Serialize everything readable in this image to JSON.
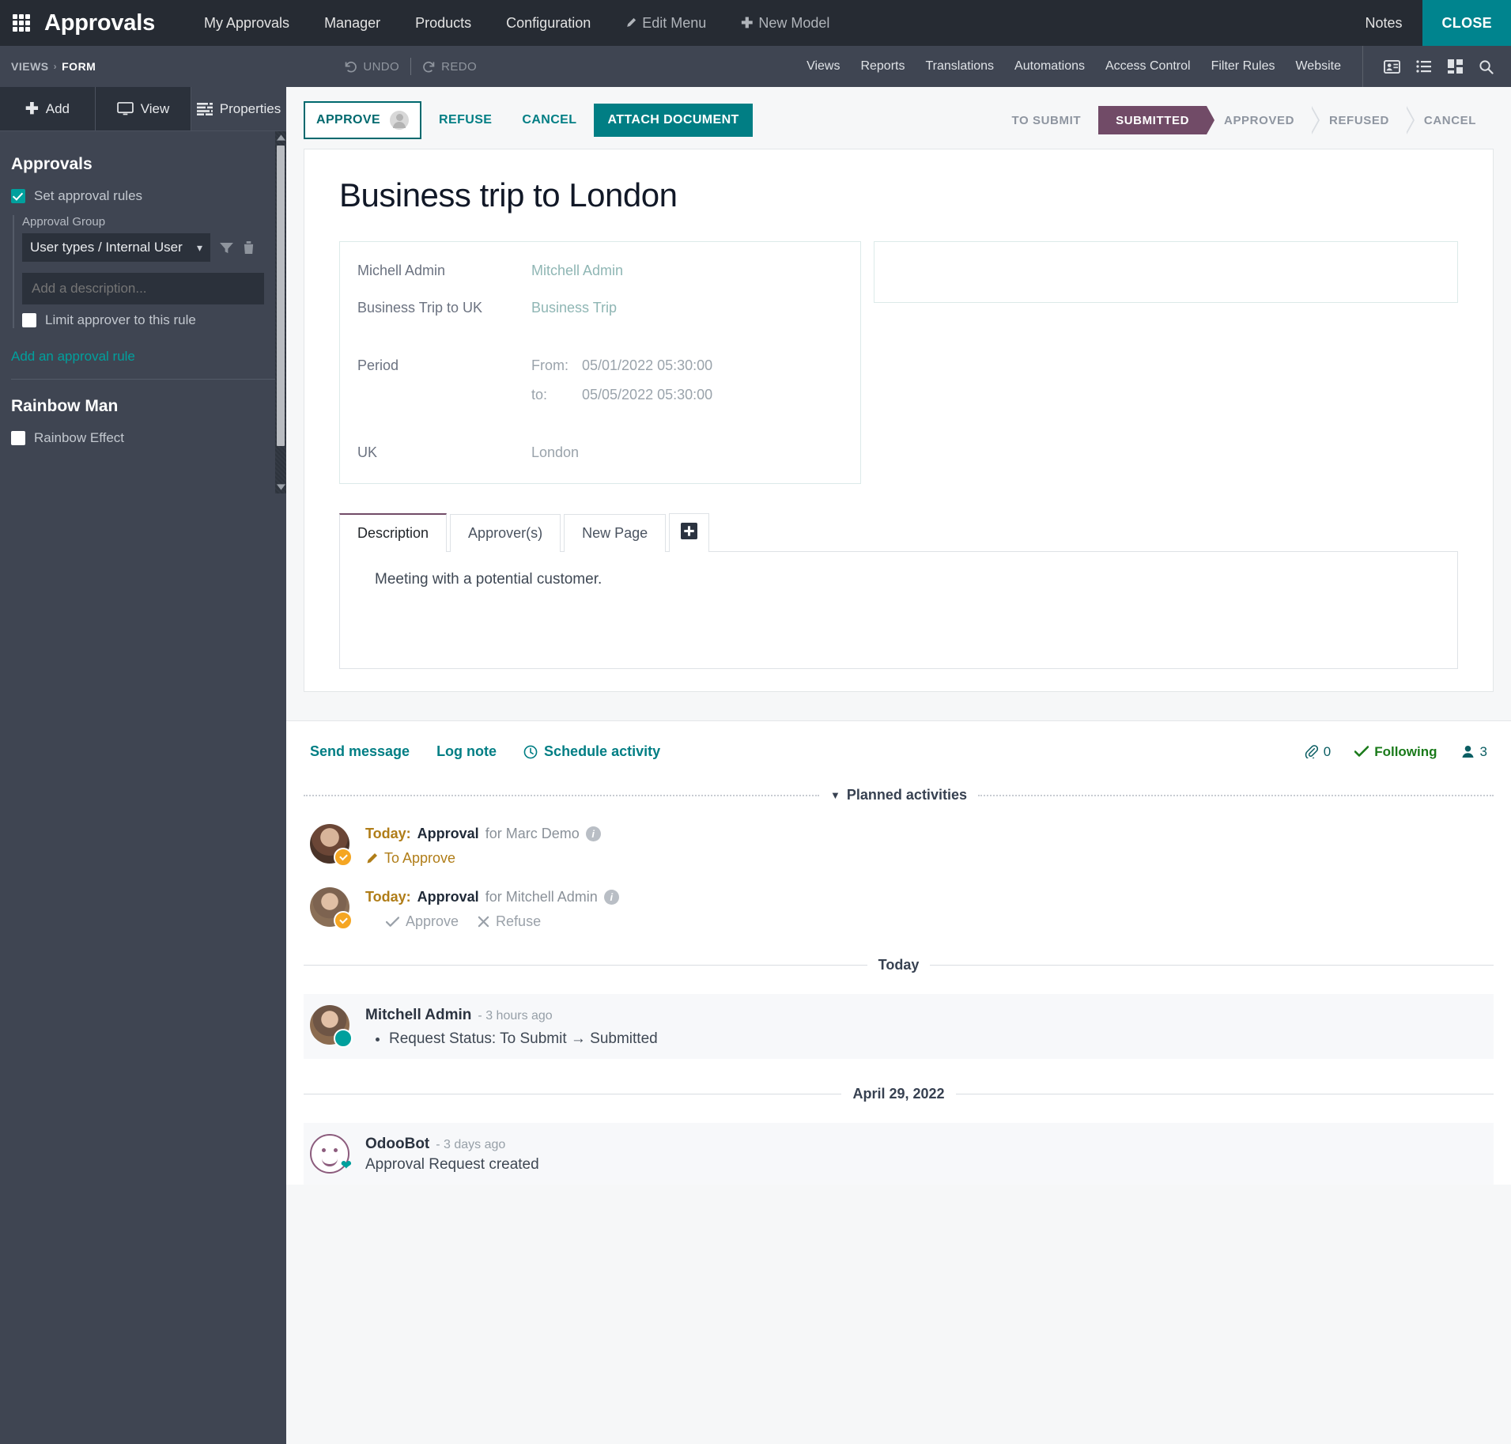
{
  "navbar": {
    "apps_icon": "apps-grid-icon",
    "brand": "Approvals",
    "menus": [
      {
        "label": "My Approvals"
      },
      {
        "label": "Manager"
      },
      {
        "label": "Products"
      },
      {
        "label": "Configuration"
      }
    ],
    "edit_menu": "Edit Menu",
    "new_model": "New Model",
    "notes": "Notes",
    "close": "CLOSE",
    "close_bg": "#00848e"
  },
  "subbar": {
    "breadcrumb_root": "VIEWS",
    "breadcrumb_sep": "›",
    "breadcrumb_current": "FORM",
    "undo": "UNDO",
    "redo": "REDO",
    "links": [
      {
        "label": "Views"
      },
      {
        "label": "Reports"
      },
      {
        "label": "Translations"
      },
      {
        "label": "Automations"
      },
      {
        "label": "Access Control"
      },
      {
        "label": "Filter Rules"
      },
      {
        "label": "Website"
      }
    ],
    "icons": [
      "contact-card-icon",
      "list-view-icon",
      "kanban-view-icon",
      "search-icon"
    ]
  },
  "sidebar": {
    "tabs": [
      {
        "label": "Add",
        "icon": "plus-icon",
        "active": false
      },
      {
        "label": "View",
        "icon": "monitor-icon",
        "active": false
      },
      {
        "label": "Properties",
        "icon": "properties-icon",
        "active": true
      }
    ],
    "sections": [
      {
        "title": "Approvals",
        "set_approval_rules": {
          "label": "Set approval rules",
          "checked": true
        },
        "approval_group_label": "Approval Group",
        "approval_group_value": "User types / Internal User",
        "description_placeholder": "Add a description...",
        "description_value": "",
        "limit_approver": {
          "label": "Limit approver to this rule",
          "checked": false
        },
        "add_rule_link": "Add an approval rule"
      },
      {
        "title": "Rainbow Man",
        "rainbow_effect": {
          "label": "Rainbow Effect",
          "checked": false
        }
      }
    ]
  },
  "record": {
    "buttons": [
      {
        "label": "APPROVE",
        "style": "outline",
        "has_avatar": true
      },
      {
        "label": "REFUSE",
        "style": "text"
      },
      {
        "label": "CANCEL",
        "style": "text"
      },
      {
        "label": "ATTACH DOCUMENT",
        "style": "fill"
      }
    ],
    "statuses": [
      {
        "label": "TO SUBMIT",
        "active": false
      },
      {
        "label": "SUBMITTED",
        "active": true
      },
      {
        "label": "APPROVED",
        "active": false
      },
      {
        "label": "REFUSED",
        "active": false
      },
      {
        "label": "CANCEL",
        "active": false
      }
    ],
    "active_status_color": "#714b67",
    "title": "Business trip to London",
    "fields": [
      {
        "label": "Michell Admin",
        "value": "Mitchell Admin",
        "link": true
      },
      {
        "label": "Business Trip to UK",
        "value": "Business Trip",
        "link": true
      }
    ],
    "period": {
      "label": "Period",
      "from_key": "From:",
      "from_value": "05/01/2022 05:30:00",
      "to_key": "to:",
      "to_value": "05/05/2022 05:30:00"
    },
    "location": {
      "label": "UK",
      "value": "London"
    },
    "notebook": {
      "tabs": [
        {
          "label": "Description",
          "active": true
        },
        {
          "label": "Approver(s)",
          "active": false
        },
        {
          "label": "New Page",
          "active": false
        }
      ],
      "add_tab_icon": "add-page-icon",
      "description_text": "Meeting with a potential customer."
    }
  },
  "chatter": {
    "send_message": "Send message",
    "log_note": "Log note",
    "schedule_activity": "Schedule activity",
    "attachment_count": "0",
    "following_label": "Following",
    "follower_count": "3",
    "planned_activities_label": "Planned activities",
    "activities": [
      {
        "when": "Today:",
        "kind": "Approval",
        "for": "for Marc Demo",
        "actions": [
          {
            "label": "To Approve",
            "icon": "pencil-icon",
            "muted": false
          }
        ]
      },
      {
        "when": "Today:",
        "kind": "Approval",
        "for": "for Mitchell Admin",
        "actions": [
          {
            "label": "Approve",
            "icon": "check-icon",
            "muted": true
          },
          {
            "label": "Refuse",
            "icon": "x-icon",
            "muted": true
          }
        ]
      }
    ],
    "groups": [
      {
        "date_label": "Today",
        "messages": [
          {
            "author": "Mitchell Admin",
            "time": "- 3 hours ago",
            "bullets": [
              "Request Status: To Submit → Submitted"
            ],
            "text": ""
          }
        ]
      },
      {
        "date_label": "April 29, 2022",
        "messages": [
          {
            "author": "OdooBot",
            "time": "- 3 days ago",
            "bullets": [],
            "text": "Approval Request created"
          }
        ]
      }
    ]
  }
}
